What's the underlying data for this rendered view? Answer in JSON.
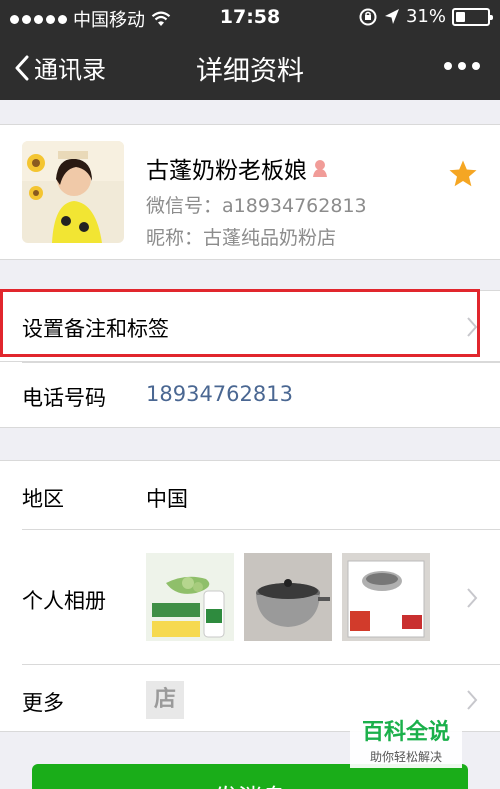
{
  "status_bar": {
    "carrier": "中国移动",
    "time": "17:58",
    "battery": "31%",
    "battery_level": 0.31
  },
  "nav": {
    "back_label": "通讯录",
    "title": "详细资料"
  },
  "profile": {
    "name": "古蓬奶粉老板娘",
    "wechat_id": "微信号：a18934762813",
    "nickname": "昵称：古蓬纯品奶粉店",
    "starred": true
  },
  "remark": {
    "label": "设置备注和标签"
  },
  "phone": {
    "label": "电话号码",
    "number": "18934762813"
  },
  "region": {
    "label": "地区",
    "value": "中国"
  },
  "album": {
    "label": "个人相册",
    "thumbnails": [
      "product-bottle-photo",
      "steel-pot-photo",
      "pot-box-photo"
    ]
  },
  "more": {
    "label": "更多",
    "icon_text": "店"
  },
  "watermark": {
    "title": "百科全说",
    "subtitle": "助你轻松解决"
  },
  "send_button": {
    "label": "发消息"
  },
  "colors": {
    "nav_bg": "#2e2e2e",
    "accent_green": "#1aad19",
    "link_blue": "#4a6792",
    "highlight_red": "#e1262d",
    "star_orange": "#f5a623",
    "page_bg": "#efeff4"
  }
}
